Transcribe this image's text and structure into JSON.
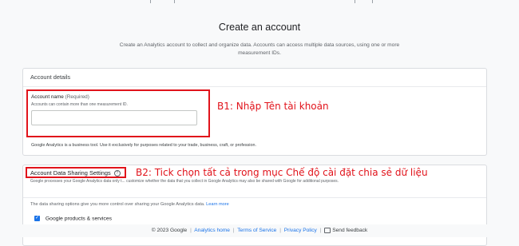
{
  "header": {
    "title": "Create an account",
    "subtitle": "Create an Analytics account to collect and organize data. Accounts can access multiple data sources, using one or more measurement IDs."
  },
  "account_details": {
    "heading": "Account details",
    "field_label": "Account name",
    "field_required": "(Required)",
    "field_hint": "Accounts can contain more than one measurement ID.",
    "field_value": "",
    "note": "Google Analytics is a business tool. Use it exclusively for purposes related to your trade, business, craft, or profession."
  },
  "data_sharing": {
    "heading": "Account Data Sharing Settings",
    "description": "Google processes your Google Analytics data only t... customize whether the data that you collect in Google Analytics may also be shared with Google for additional purposes.",
    "intro": "The data sharing options give you more control over sharing your Google Analytics data.",
    "learn_more": "Learn more",
    "option1": "Google products & services",
    "option1_checked": true
  },
  "annotations": {
    "step1": "B1: Nhập Tên tài khoản",
    "step2": "B2: Tick chọn tất cả trong mục Chế độ cài đặt chia sẻ dữ liệu"
  },
  "footer": {
    "copyright": "© 2023 Google",
    "link1": "Analytics home",
    "link2": "Terms of Service",
    "link3": "Privacy Policy",
    "link4": "Send feedback",
    "separator": "|"
  },
  "colors": {
    "accent": "#1a73e8",
    "annotation": "#e1131b"
  },
  "icons": [
    "help-icon",
    "checkbox-checked-icon",
    "feedback-icon"
  ]
}
